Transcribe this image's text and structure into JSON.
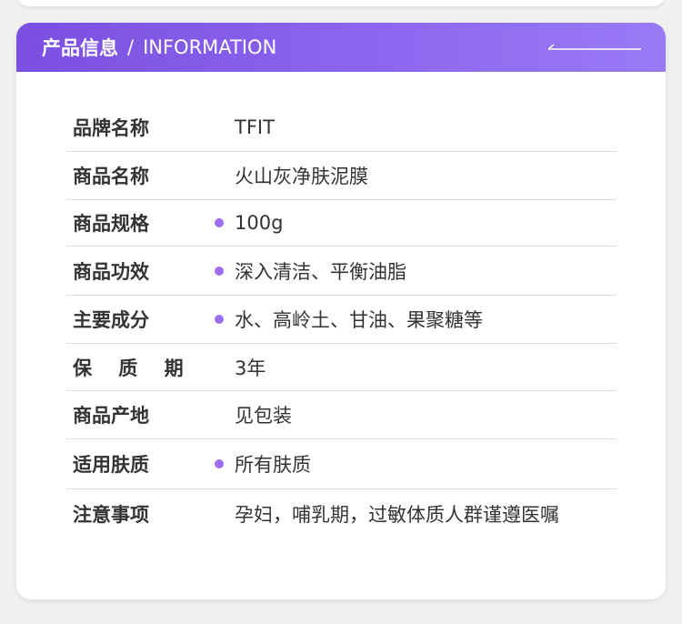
{
  "header": {
    "title_cn": "产品信息",
    "separator": "/",
    "title_en": "INFORMATION"
  },
  "rows": [
    {
      "label": "品牌名称",
      "value": "TFIT",
      "bullet": false
    },
    {
      "label": "商品名称",
      "value": "火山灰净肤泥膜",
      "bullet": false
    },
    {
      "label": "商品规格",
      "value": "100g",
      "bullet": true
    },
    {
      "label": "商品功效",
      "value": "深入清洁、平衡油脂",
      "bullet": true
    },
    {
      "label": "主要成分",
      "value": "水、高岭土、甘油、果聚糖等",
      "bullet": true
    },
    {
      "label": "保 质 期",
      "value": "3年",
      "bullet": false
    },
    {
      "label": "商品产地",
      "value": "见包装",
      "bullet": false
    },
    {
      "label": "适用肤质",
      "value": "所有肤质",
      "bullet": true
    },
    {
      "label": "注意事项",
      "value": "孕妇，哺乳期，过敏体质人群谨遵医嘱",
      "bullet": false
    }
  ],
  "colors": {
    "header_gradient_start": "#7b4fe0",
    "header_gradient_end": "#9a7af5",
    "bullet": "#9d6ff0",
    "text": "#333333",
    "divider": "#dedede"
  }
}
